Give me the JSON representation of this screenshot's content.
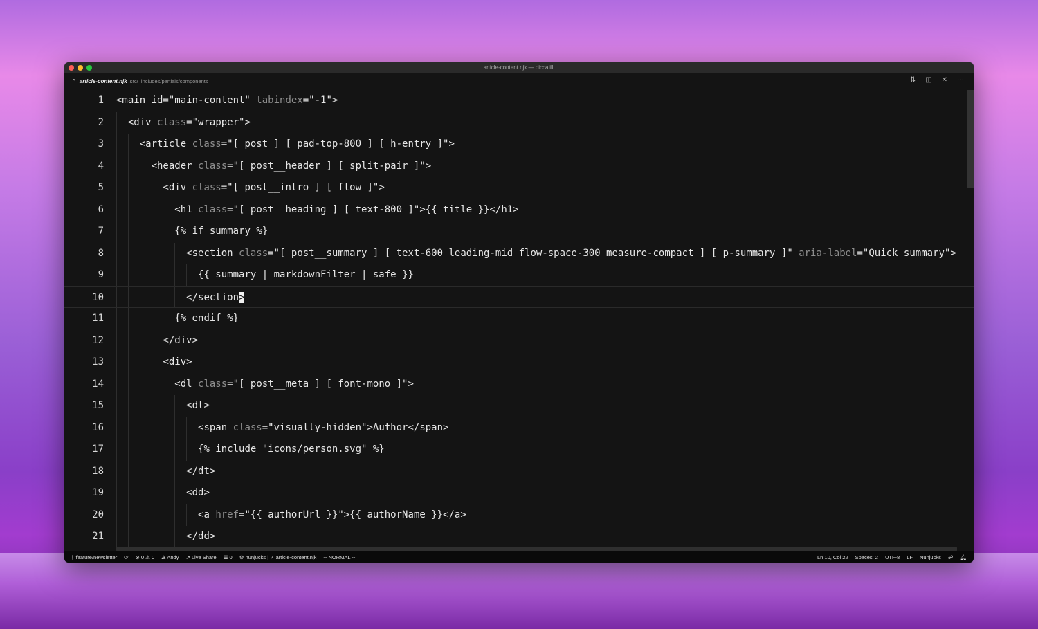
{
  "window": {
    "title": "article-content.njk — piccalilli",
    "traffic_colors": [
      "#fe5f57",
      "#febc2e",
      "#28c840"
    ]
  },
  "tab": {
    "file": "article-content.njk",
    "path": "src/_includes/partials/components"
  },
  "editor": {
    "cursor_line": 10,
    "lines": [
      {
        "n": "1",
        "indent": 0,
        "tokens": [
          [
            "t",
            "<main id=\"main-content\" "
          ],
          [
            "a",
            "tabindex"
          ],
          [
            "t",
            "=\"-1\">"
          ]
        ]
      },
      {
        "n": "2",
        "indent": 1,
        "tokens": [
          [
            "t",
            "<div "
          ],
          [
            "a",
            "class"
          ],
          [
            "t",
            "=\"wrapper\">"
          ]
        ]
      },
      {
        "n": "3",
        "indent": 2,
        "tokens": [
          [
            "t",
            "<article "
          ],
          [
            "a",
            "class"
          ],
          [
            "t",
            "=\"[ post ] [ pad-top-800 ] [ h-entry ]\">"
          ]
        ]
      },
      {
        "n": "4",
        "indent": 3,
        "tokens": [
          [
            "t",
            "<header "
          ],
          [
            "a",
            "class"
          ],
          [
            "t",
            "=\"[ post__header ] [ split-pair ]\">"
          ]
        ]
      },
      {
        "n": "5",
        "indent": 4,
        "tokens": [
          [
            "t",
            "<div "
          ],
          [
            "a",
            "class"
          ],
          [
            "t",
            "=\"[ post__intro ] [ flow ]\">"
          ]
        ]
      },
      {
        "n": "6",
        "indent": 5,
        "tokens": [
          [
            "t",
            "<h1 "
          ],
          [
            "a",
            "class"
          ],
          [
            "t",
            "=\"[ post__heading ] [ text-800 ]\">{{ title }}</h1>"
          ]
        ]
      },
      {
        "n": "7",
        "indent": 5,
        "tokens": [
          [
            "t",
            "{% if summary %}"
          ]
        ]
      },
      {
        "n": "8",
        "indent": 6,
        "tokens": [
          [
            "t",
            "<section "
          ],
          [
            "a",
            "class"
          ],
          [
            "t",
            "=\"[ post__summary ] [ text-600 leading-mid flow-space-300 measure-compact ] [ p-summary ]\" "
          ],
          [
            "a",
            "aria-label"
          ],
          [
            "t",
            "=\"Quick summary\">"
          ]
        ]
      },
      {
        "n": "9",
        "indent": 7,
        "tokens": [
          [
            "t",
            "{{ summary | markdownFilter | safe }}"
          ]
        ]
      },
      {
        "n": "10",
        "indent": 6,
        "tokens": [
          [
            "t",
            "</section"
          ],
          [
            "c",
            ">"
          ]
        ]
      },
      {
        "n": "11",
        "indent": 5,
        "tokens": [
          [
            "t",
            "{% endif %}"
          ]
        ]
      },
      {
        "n": "12",
        "indent": 4,
        "tokens": [
          [
            "t",
            "</div>"
          ]
        ]
      },
      {
        "n": "13",
        "indent": 4,
        "tokens": [
          [
            "t",
            "<div>"
          ]
        ]
      },
      {
        "n": "14",
        "indent": 5,
        "tokens": [
          [
            "t",
            "<dl "
          ],
          [
            "a",
            "class"
          ],
          [
            "t",
            "=\"[ post__meta ] [ font-mono ]\">"
          ]
        ]
      },
      {
        "n": "15",
        "indent": 6,
        "tokens": [
          [
            "t",
            "<dt>"
          ]
        ]
      },
      {
        "n": "16",
        "indent": 7,
        "tokens": [
          [
            "t",
            "<span "
          ],
          [
            "a",
            "class"
          ],
          [
            "t",
            "=\"visually-hidden\">Author</span>"
          ]
        ]
      },
      {
        "n": "17",
        "indent": 7,
        "tokens": [
          [
            "t",
            "{% include \"icons/person.svg\" %}"
          ]
        ]
      },
      {
        "n": "18",
        "indent": 6,
        "tokens": [
          [
            "t",
            "</dt>"
          ]
        ]
      },
      {
        "n": "19",
        "indent": 6,
        "tokens": [
          [
            "t",
            "<dd>"
          ]
        ]
      },
      {
        "n": "20",
        "indent": 7,
        "tokens": [
          [
            "t",
            "<a "
          ],
          [
            "a",
            "href"
          ],
          [
            "t",
            "=\"{{ authorUrl }}\">{{ authorName }}</a>"
          ]
        ]
      },
      {
        "n": "21",
        "indent": 6,
        "tokens": [
          [
            "t",
            "</dd>"
          ]
        ]
      }
    ]
  },
  "status": {
    "branch": "feature/newsletter",
    "sync": "⟳",
    "errors": "0",
    "warnings": "0",
    "user": "Andy",
    "liveshare": "Live Share",
    "tasks": "0",
    "lint": "nunjucks | ✓ article-content.njk",
    "mode": "-- NORMAL --",
    "position": "Ln 10, Col 22",
    "spaces": "Spaces: 2",
    "encoding": "UTF-8",
    "eol": "LF",
    "language": "Nunjucks"
  }
}
